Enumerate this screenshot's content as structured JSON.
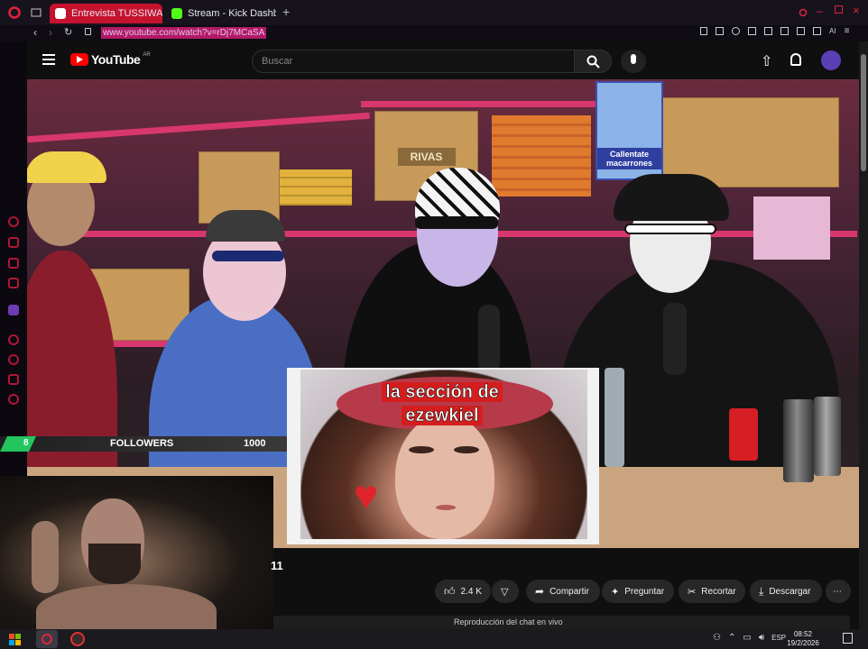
{
  "browser": {
    "tabs": [
      {
        "label": "Entrevista TUSSIWARR"
      },
      {
        "label": "Stream - Kick Dashboard"
      }
    ],
    "url": "www.youtube.com/watch?v=rDj7MCaSA"
  },
  "youtube": {
    "logo_text": "YouTube",
    "region": "AR",
    "search_placeholder": "Buscar",
    "video_title_fragment": "11",
    "actions": {
      "likes": "2.4 K",
      "share": "Compartir",
      "ask": "Preguntar",
      "clip": "Recortar",
      "download": "Descargar"
    },
    "chat_replay": "Reproducción del chat en vivo"
  },
  "stream_overlay": {
    "card_title_line1": "la sección de",
    "card_title_line2": "ezewkiel",
    "followers_label": "FOLLOWERS",
    "followers_current": "8",
    "followers_goal": "1000"
  },
  "video_text": {
    "box_brand": "RIVAS",
    "poster_text": "Callentate macarrones"
  },
  "taskbar": {
    "language": "ESP",
    "time": "08:52",
    "date": "19/2/2026"
  },
  "colors": {
    "opera_red": "#c4122f",
    "youtube_red": "#ff0000",
    "followers_green": "#22c55e"
  }
}
